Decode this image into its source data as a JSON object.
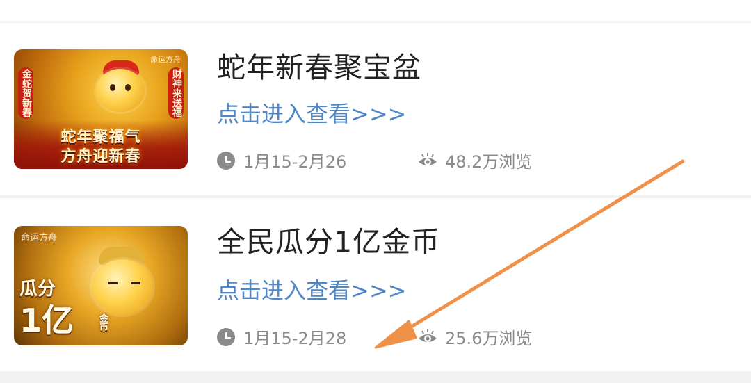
{
  "items": [
    {
      "title": "蛇年新春聚宝盆",
      "link": "点击进入查看>>>",
      "date": "1月15-2月26",
      "views": "48.2万浏览",
      "thumbnail": {
        "brand": "命运方舟",
        "side_left": "金蛇贺新春",
        "side_right": "财神来送福",
        "promo_line1": "蛇年聚福气",
        "promo_line2": "方舟迎新春"
      }
    },
    {
      "title": "全民瓜分1亿金币",
      "link": "点击进入查看>>>",
      "date": "1月15-2月28",
      "views": "25.6万浏览",
      "thumbnail": {
        "brand": "命运方舟",
        "promo_line1": "瓜分",
        "promo_line2": "1亿",
        "promo_line3": "金币"
      }
    }
  ],
  "icons": {
    "clock": "clock-icon",
    "views": "eye-icon"
  },
  "colors": {
    "link": "#4f86c6",
    "title": "#222222",
    "meta": "#8a8a8a",
    "annotation_arrow": "#f0914a"
  }
}
